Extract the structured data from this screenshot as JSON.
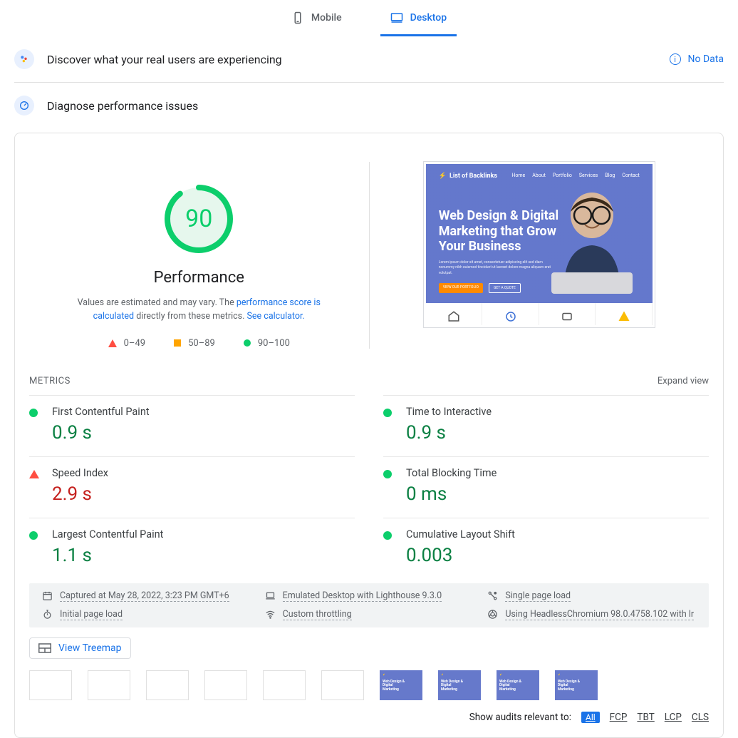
{
  "tabs": {
    "mobile": "Mobile",
    "desktop": "Desktop"
  },
  "discover": {
    "title": "Discover what your real users are experiencing",
    "no_data": "No Data"
  },
  "diagnose": {
    "title": "Diagnose performance issues"
  },
  "score": {
    "value": "90",
    "label": "Performance",
    "desc_prefix": "Values are estimated and may vary. The ",
    "link1": "performance score is calculated",
    "desc_middle": " directly from these metrics. ",
    "link2": "See calculator."
  },
  "legend": {
    "red": "0–49",
    "amber": "50–89",
    "green": "90–100"
  },
  "preview": {
    "site_title": "List of Backlinks",
    "nav": [
      "Home",
      "About",
      "Portfolio",
      "Services",
      "Blog",
      "Contact"
    ],
    "headline": "Web Design & Digital Marketing that Grow Your Business",
    "btn1": "VIEW OUR PORTFOLIO",
    "btn2": "GET A QUOTE"
  },
  "metrics": {
    "header": "Metrics",
    "expand": "Expand view",
    "items": [
      {
        "name": "First Contentful Paint",
        "value": "0.9 s",
        "status": "green"
      },
      {
        "name": "Time to Interactive",
        "value": "0.9 s",
        "status": "green"
      },
      {
        "name": "Speed Index",
        "value": "2.9 s",
        "status": "red"
      },
      {
        "name": "Total Blocking Time",
        "value": "0 ms",
        "status": "green"
      },
      {
        "name": "Largest Contentful Paint",
        "value": "1.1 s",
        "status": "green"
      },
      {
        "name": "Cumulative Layout Shift",
        "value": "0.003",
        "status": "green"
      }
    ]
  },
  "env": {
    "captured": "Captured at May 28, 2022, 3:23 PM GMT+6",
    "emulated": "Emulated Desktop with Lighthouse 9.3.0",
    "single": "Single page load",
    "initial": "Initial page load",
    "throttling": "Custom throttling",
    "browser": "Using HeadlessChromium 98.0.4758.102 with lr"
  },
  "treemap": "View Treemap",
  "audits": {
    "label": "Show audits relevant to:",
    "all": "All",
    "fcp": "FCP",
    "tbt": "TBT",
    "lcp": "LCP",
    "cls": "CLS"
  },
  "chart_data": {
    "type": "gauge",
    "title": "Performance",
    "value": 90,
    "ranges": [
      {
        "label": "0–49",
        "color": "#ff4e42"
      },
      {
        "label": "50–89",
        "color": "#ffa400"
      },
      {
        "label": "90–100",
        "color": "#0cce6b"
      }
    ],
    "metrics": [
      {
        "name": "First Contentful Paint",
        "value": 0.9,
        "unit": "s",
        "status": "good"
      },
      {
        "name": "Time to Interactive",
        "value": 0.9,
        "unit": "s",
        "status": "good"
      },
      {
        "name": "Speed Index",
        "value": 2.9,
        "unit": "s",
        "status": "poor"
      },
      {
        "name": "Total Blocking Time",
        "value": 0,
        "unit": "ms",
        "status": "good"
      },
      {
        "name": "Largest Contentful Paint",
        "value": 1.1,
        "unit": "s",
        "status": "good"
      },
      {
        "name": "Cumulative Layout Shift",
        "value": 0.003,
        "unit": "",
        "status": "good"
      }
    ]
  }
}
